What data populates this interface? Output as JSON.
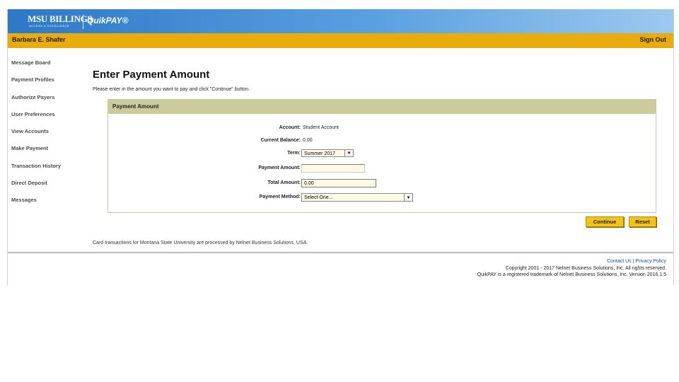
{
  "brand": {
    "university": "MSU BILLINGS",
    "tagline": "ACCESS & EXCELLENCE",
    "product": "QuikPAY®",
    "colors": {
      "banner": "#2d78c7",
      "userbar": "#e8ac0d",
      "panel_header": "#cccb9c",
      "button": "#f2c318"
    }
  },
  "userbar": {
    "user_name": "Barbara E. Shafer",
    "sign_out": "Sign Out"
  },
  "sidebar": {
    "items": [
      {
        "label": "Message Board"
      },
      {
        "label": "Payment Profiles"
      },
      {
        "label": "Authorize Payers"
      },
      {
        "label": "User Preferences"
      },
      {
        "label": "View Accounts"
      },
      {
        "label": "Make Payment"
      },
      {
        "label": "Transaction History"
      },
      {
        "label": "Direct Deposit"
      },
      {
        "label": "Messages"
      }
    ]
  },
  "main": {
    "title": "Enter Payment Amount",
    "instructions": "Please enter in the amount you want to pay and click \"Continue\" button.",
    "panel_title": "Payment Amount",
    "fields": {
      "account_label": "Account:",
      "account_value": "Student Account",
      "balance_label": "Current Balance:",
      "balance_value": "0.00",
      "term_label": "Term:",
      "term_value": "Summer 2017",
      "payment_amount_label": "Payment Amount:",
      "payment_amount_value": "",
      "total_amount_label": "Total Amount:",
      "total_amount_value": "0.00",
      "payment_method_label": "Payment Method:",
      "payment_method_value": "Select One..."
    },
    "buttons": {
      "continue": "Continue",
      "reset": "Reset"
    },
    "footnote": "Card transactions for Montana State University are processed by Nelnet Business Solutions, USA."
  },
  "footer": {
    "contact_us": "Contact Us",
    "separator": "|",
    "privacy_policy": "Privacy Policy",
    "copyright": "Copyright 2001 - 2017 Nelnet Business Solutions, Inc. All rights reserved.",
    "trademark": "QuikPAY is a registered trademark of Nelnet Business Solutions, Inc. Version 2016.1.5"
  }
}
